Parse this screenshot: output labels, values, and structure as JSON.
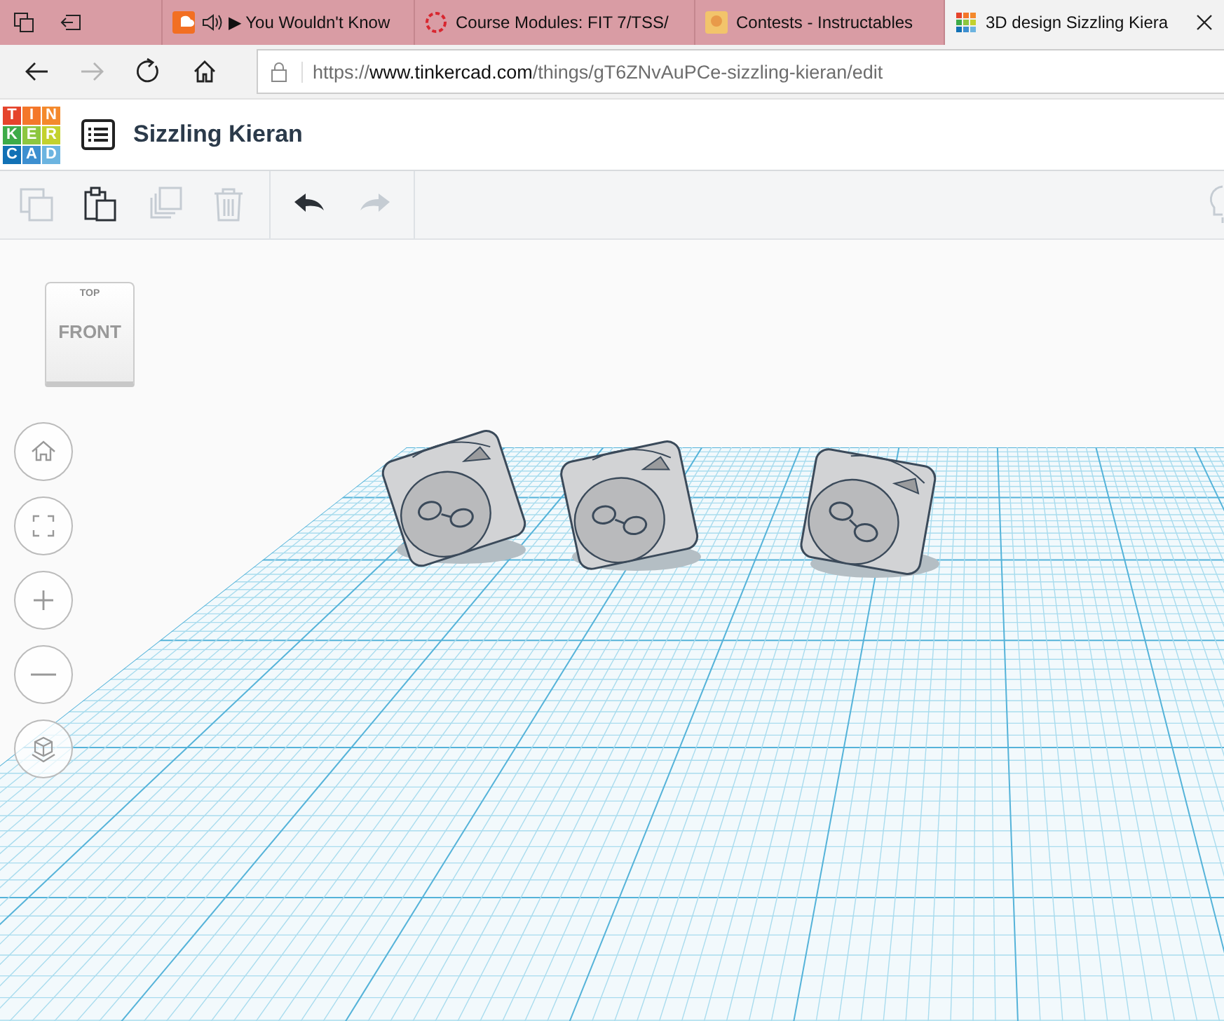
{
  "browser": {
    "tabs": [
      {
        "title": "▶ You Wouldn't Know",
        "audio": true,
        "selected": false
      },
      {
        "title": "Course Modules: FIT 7/TSS/",
        "audio": false,
        "selected": false
      },
      {
        "title": "Contests - Instructables",
        "audio": false,
        "selected": false
      },
      {
        "title": "3D design Sizzling Kiera",
        "audio": false,
        "selected": true
      }
    ],
    "nav_buttons": [
      {
        "kind": "back",
        "disabled": false
      },
      {
        "kind": "forward",
        "disabled": true
      },
      {
        "kind": "refresh",
        "disabled": false
      },
      {
        "kind": "home",
        "disabled": false
      }
    ],
    "url": {
      "scheme": "https://",
      "host": "www.tinkercad.com",
      "path": "/things/gT6ZNvAuPCe-sizzling-kieran/edit"
    }
  },
  "app": {
    "logo": [
      {
        "letter": "T",
        "color": "#e5442c"
      },
      {
        "letter": "I",
        "color": "#f4772a"
      },
      {
        "letter": "N",
        "color": "#f4892c"
      },
      {
        "letter": "K",
        "color": "#3eab49"
      },
      {
        "letter": "E",
        "color": "#8dc63f"
      },
      {
        "letter": "R",
        "color": "#c3d12e"
      },
      {
        "letter": "C",
        "color": "#1271b5"
      },
      {
        "letter": "A",
        "color": "#3d8fd0"
      },
      {
        "letter": "D",
        "color": "#6cb4e0"
      }
    ],
    "design_title": "Sizzling Kieran",
    "tools": [
      {
        "kind": "copy",
        "disabled": true
      },
      {
        "kind": "paste",
        "disabled": false
      },
      {
        "kind": "duplicate",
        "disabled": true
      },
      {
        "kind": "delete",
        "disabled": true
      },
      {
        "kind": "undo",
        "disabled": false
      },
      {
        "kind": "redo",
        "disabled": true
      }
    ],
    "view_cube": {
      "top": "TOP",
      "front": "FRONT"
    },
    "view_controls": [
      {
        "kind": "home"
      },
      {
        "kind": "fit"
      },
      {
        "kind": "zoom_in"
      },
      {
        "kind": "zoom_out"
      },
      {
        "kind": "perspective"
      }
    ]
  }
}
